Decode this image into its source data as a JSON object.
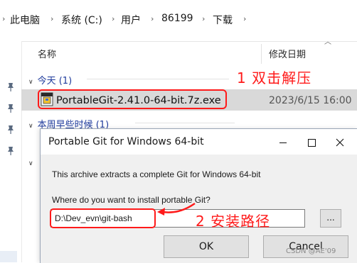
{
  "breadcrumb": {
    "items": [
      "此电脑",
      "系统 (C:)",
      "用户",
      "86199",
      "下载"
    ]
  },
  "columns": {
    "name": "名称",
    "modified": "修改日期"
  },
  "groups": {
    "today": "今天 (1)",
    "earlier_this_week": "本周早些时候 (1)"
  },
  "file": {
    "name": "PortableGit-2.41.0-64-bit.7z.exe",
    "date": "2023/6/15 16:00"
  },
  "annotations": {
    "step1": "1 双击解压",
    "step2": "2 安装路径",
    "color": "#ff1a1a"
  },
  "dialog": {
    "title": "Portable Git for Windows 64-bit",
    "description": "This archive extracts a complete Git for Windows 64-bit",
    "question": "Where do you want to install portable Git?",
    "path_value": "D:\\Dev_evn\\git-bash",
    "browse_label": "...",
    "ok_label": "OK",
    "cancel_label": "Cancel"
  },
  "watermark": "CSDN @AE'09"
}
